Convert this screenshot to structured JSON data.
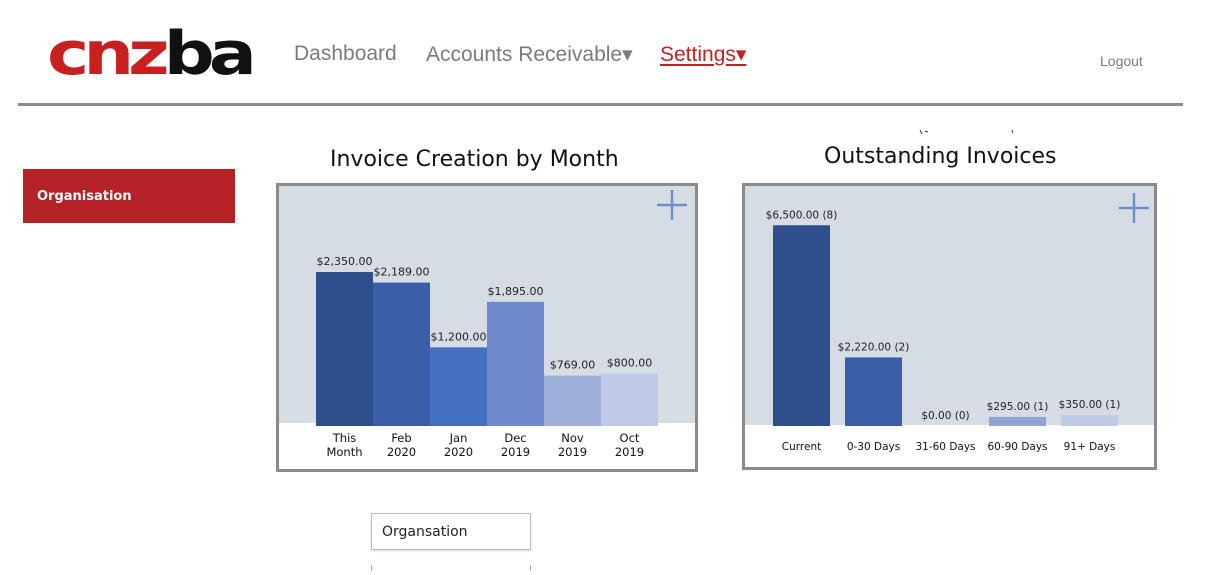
{
  "header": {
    "logo_text": "cnzba",
    "nav": [
      {
        "label": "Dashboard",
        "active": false
      },
      {
        "label": "Accounts Receivable▾",
        "active": false
      },
      {
        "label": "Settings▾",
        "active": true
      }
    ],
    "logout_label": "Logout"
  },
  "sidebar": {
    "items": [
      {
        "label": "Organisation",
        "active": true
      }
    ]
  },
  "colors": {
    "brand_red": "#c8201f",
    "sidebar_red": "#b52226",
    "panel_bg": "#d6dce4"
  },
  "panel_icons": [
    "plus-icon",
    "plus-icon"
  ],
  "dropdown": {
    "value": "Organsation"
  },
  "chart_data": [
    {
      "type": "bar",
      "title": "Invoice Creation by Month",
      "categories": [
        "This\nMonth",
        "Feb\n2020",
        "Jan\n2020",
        "Dec\n2019",
        "Nov\n2019",
        "Oct\n2019"
      ],
      "values": [
        2350,
        2189,
        1200,
        1895,
        769,
        800
      ],
      "labels": [
        "$2,350.00",
        "$2,189.00",
        "$1,200.00",
        "$1,895.00",
        "$769.00",
        "$800.00"
      ],
      "colors": [
        "#2e4e8c",
        "#3a5ea8",
        "#4370c1",
        "#7089cd",
        "#9eb0da",
        "#bfcae6"
      ],
      "ylim": [
        0,
        2900
      ],
      "grid": false,
      "legend": "none"
    },
    {
      "type": "bar",
      "title": "Outstanding Invoices",
      "categories": [
        "Current",
        "0-30 Days",
        "31-60 Days",
        "60-90 Days",
        "91+ Days"
      ],
      "values": [
        6500,
        2220,
        0,
        295,
        350
      ],
      "labels": [
        "$6,500.00 (8)",
        "$2,220.00 (2)",
        "$0.00 (0)",
        "$295.00 (1)",
        "$350.00 (1)"
      ],
      "colors": [
        "#2e4e8c",
        "#3a5ea8",
        "#4370c1",
        "#8fa3d6",
        "#bfcae6"
      ],
      "ylim": [
        0,
        6800
      ],
      "grid": false,
      "legend": "none"
    }
  ]
}
